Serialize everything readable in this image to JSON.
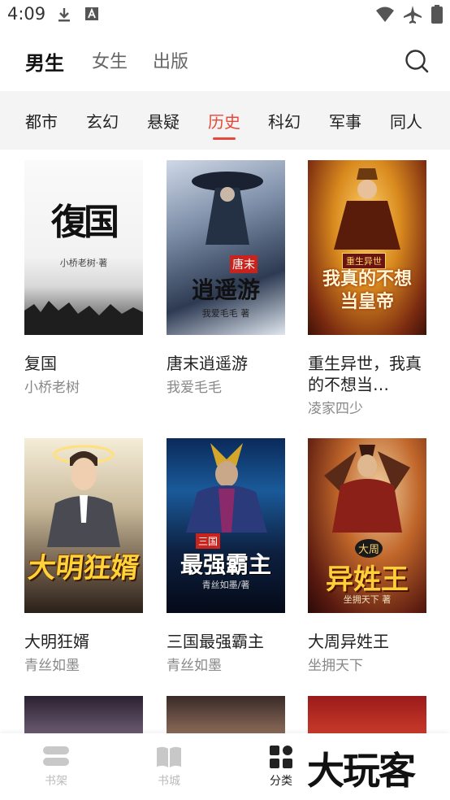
{
  "status_bar": {
    "time": "4:09"
  },
  "header": {
    "tabs": [
      {
        "label": "男生",
        "active": true
      },
      {
        "label": "女生",
        "active": false
      },
      {
        "label": "出版",
        "active": false
      }
    ]
  },
  "categories": [
    {
      "label": "都市",
      "active": false
    },
    {
      "label": "玄幻",
      "active": false
    },
    {
      "label": "悬疑",
      "active": false
    },
    {
      "label": "历史",
      "active": true
    },
    {
      "label": "科幻",
      "active": false
    },
    {
      "label": "军事",
      "active": false
    },
    {
      "label": "同人",
      "active": false
    }
  ],
  "books": [
    {
      "name": "复国",
      "author": "小桥老树",
      "cover_title": "復国",
      "cover_author": "小桥老树·著"
    },
    {
      "name": "唐末逍遥游",
      "author": "我爱毛毛",
      "cover_title": "逍遥游",
      "cover_badge": "唐末",
      "cover_author": "我爱毛毛 著"
    },
    {
      "name": "重生异世，我真的不想当…",
      "author": "凌家四少",
      "cover_title": "我真的不想当皇帝",
      "cover_badge": "重生异世"
    },
    {
      "name": "大明狂婿",
      "author": "青丝如墨",
      "cover_title": "大明狂婿"
    },
    {
      "name": "三国最强霸主",
      "author": "青丝如墨",
      "cover_title": "最强霸主",
      "cover_badge": "三国",
      "cover_author": "青丝如墨/著"
    },
    {
      "name": "大周异姓王",
      "author": "坐拥天下",
      "cover_title": "异姓王",
      "cover_badge": "大周",
      "cover_author": "坐拥天下 著"
    }
  ],
  "bottom_nav": [
    {
      "label": "书架",
      "icon": "bookshelf-icon",
      "active": false
    },
    {
      "label": "书城",
      "icon": "book-open-icon",
      "active": false
    },
    {
      "label": "分类",
      "icon": "grid-icon",
      "active": true
    }
  ],
  "watermark": "大玩客",
  "colors": {
    "accent": "#e8483a",
    "cat_bg": "#f4f4f4"
  }
}
